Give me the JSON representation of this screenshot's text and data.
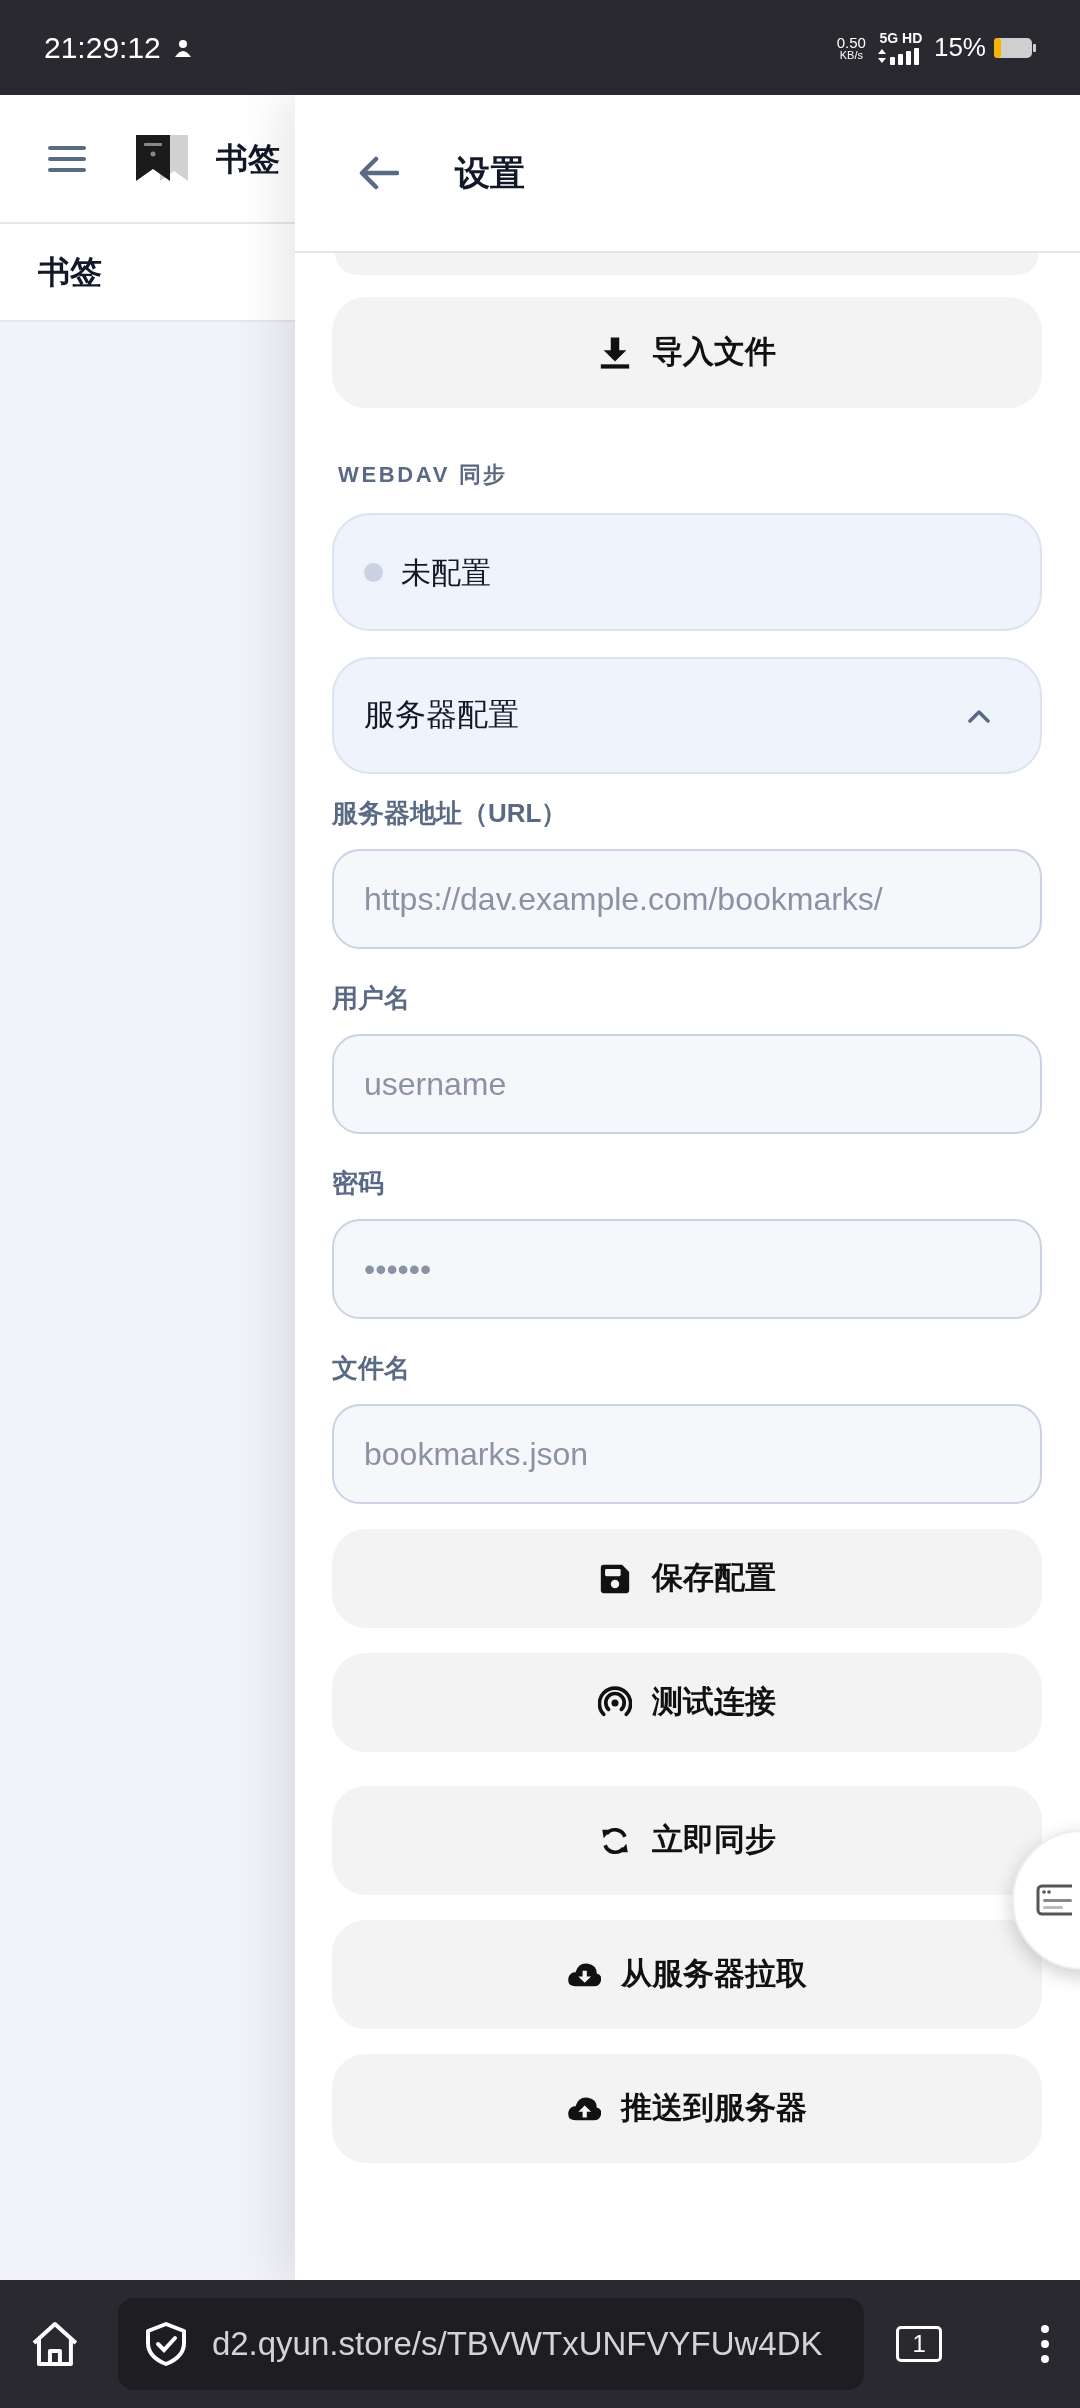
{
  "status_bar": {
    "time": "21:29:12",
    "speed_value": "0.50",
    "speed_unit": "KB/s",
    "network": "5G HD",
    "battery": "15%"
  },
  "background_app": {
    "title": "书签",
    "section": "书签"
  },
  "settings": {
    "title": "设置",
    "import_button": {
      "label": "导入文件",
      "kind": "download"
    },
    "section_label": "WEBDAV 同步",
    "status": {
      "text": "未配置",
      "color": "#c9d3e4"
    },
    "server_config": {
      "title": "服务器配置",
      "expanded": true
    },
    "fields": [
      {
        "label": "服务器地址（URL）",
        "placeholder": "https://dav.example.com/bookmarks/"
      },
      {
        "label": "用户名",
        "placeholder": "username"
      },
      {
        "label": "密码",
        "placeholder": "••••••"
      },
      {
        "label": "文件名",
        "placeholder": "bookmarks.json"
      }
    ],
    "config_buttons": [
      {
        "label": "保存配置",
        "kind": "save"
      },
      {
        "label": "测试连接",
        "kind": "signal"
      }
    ],
    "sync_buttons": [
      {
        "label": "立即同步",
        "kind": "sync"
      },
      {
        "label": "从服务器拉取",
        "kind": "cloud-download"
      },
      {
        "label": "推送到服务器",
        "kind": "cloud-upload"
      }
    ]
  },
  "browser_bar": {
    "url": "d2.qyun.store/s/TBVWTxUNFVYFUw4DK",
    "tab_count": "1"
  }
}
